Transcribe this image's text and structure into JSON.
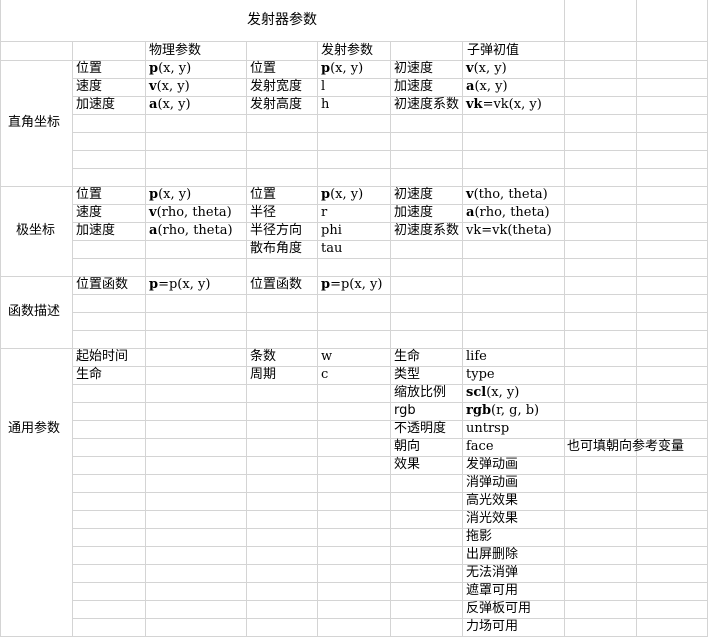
{
  "title": "发射器参数",
  "columns": {
    "physical": "物理参数",
    "emitter": "发射参数",
    "bullet": "子弹初值"
  },
  "sections": {
    "cartesian": {
      "label": "直角坐标",
      "phys": [
        {
          "name": "位置",
          "sym": "p",
          "args": "(x, y)"
        },
        {
          "name": "速度",
          "sym": "v",
          "args": "(x, y)"
        },
        {
          "name": "加速度",
          "sym": "a",
          "args": "(x, y)"
        }
      ],
      "emit": [
        {
          "name": "位置",
          "sym": "p",
          "args": "(x, y)"
        },
        {
          "name": "发射宽度",
          "sym": "",
          "args": "l"
        },
        {
          "name": "发射高度",
          "sym": "",
          "args": "h"
        }
      ],
      "bullet": [
        {
          "name": "初速度",
          "sym": "v",
          "args": "(x, y)"
        },
        {
          "name": "加速度",
          "sym": "a",
          "args": "(x, y)"
        },
        {
          "name": "初速度系数",
          "sym": "vk",
          "args": "=vk(x, y)"
        }
      ]
    },
    "polar": {
      "label": "极坐标",
      "phys": [
        {
          "name": "位置",
          "sym": "p",
          "args": "(x, y)"
        },
        {
          "name": "速度",
          "sym": "v",
          "args": "(rho, theta)"
        },
        {
          "name": "加速度",
          "sym": "a",
          "args": "(rho, theta)"
        }
      ],
      "emit": [
        {
          "name": "位置",
          "sym": "p",
          "args": "(x, y)"
        },
        {
          "name": "半径",
          "sym": "",
          "args": "r"
        },
        {
          "name": "半径方向",
          "sym": "",
          "args": "phi"
        },
        {
          "name": "散布角度",
          "sym": "",
          "args": "tau"
        }
      ],
      "bullet": [
        {
          "name": "初速度",
          "sym": "v",
          "args": "(tho, theta)"
        },
        {
          "name": "加速度",
          "sym": "a",
          "args": "(rho, theta)"
        },
        {
          "name": "初速度系数",
          "sym": "",
          "args": "vk=vk(theta)"
        }
      ]
    },
    "function": {
      "label": "函数描述",
      "phys": [
        {
          "name": "位置函数",
          "sym": "p",
          "args": "=p(x, y)"
        }
      ],
      "emit": [
        {
          "name": "位置函数",
          "sym": "p",
          "args": "=p(x, y)"
        }
      ]
    },
    "general": {
      "label": "通用参数",
      "phys": [
        {
          "name": "起始时间",
          "sym": "",
          "args": ""
        },
        {
          "name": "生命",
          "sym": "",
          "args": ""
        }
      ],
      "emit": [
        {
          "name": "条数",
          "sym": "",
          "args": "w"
        },
        {
          "name": "周期",
          "sym": "",
          "args": "c"
        }
      ],
      "bullet": [
        {
          "name": "生命",
          "sym": "",
          "args": "life"
        },
        {
          "name": "类型",
          "sym": "",
          "args": "type"
        },
        {
          "name": "缩放比例",
          "sym": "scl",
          "args": "(x, y)"
        },
        {
          "name": "rgb",
          "sym": "rgb",
          "args": "(r, g, b)"
        },
        {
          "name": "不透明度",
          "sym": "",
          "args": "untrsp"
        },
        {
          "name": "朝向",
          "sym": "",
          "args": "face"
        },
        {
          "name": "效果",
          "sym": "",
          "args": "发弹动画"
        }
      ],
      "effects": [
        "消弹动画",
        "高光效果",
        "消光效果",
        "拖影",
        "出屏删除",
        "无法消弹",
        "遮罩可用",
        "反弹板可用",
        "力场可用"
      ],
      "face_note": "也可填朝向参考变量"
    }
  }
}
